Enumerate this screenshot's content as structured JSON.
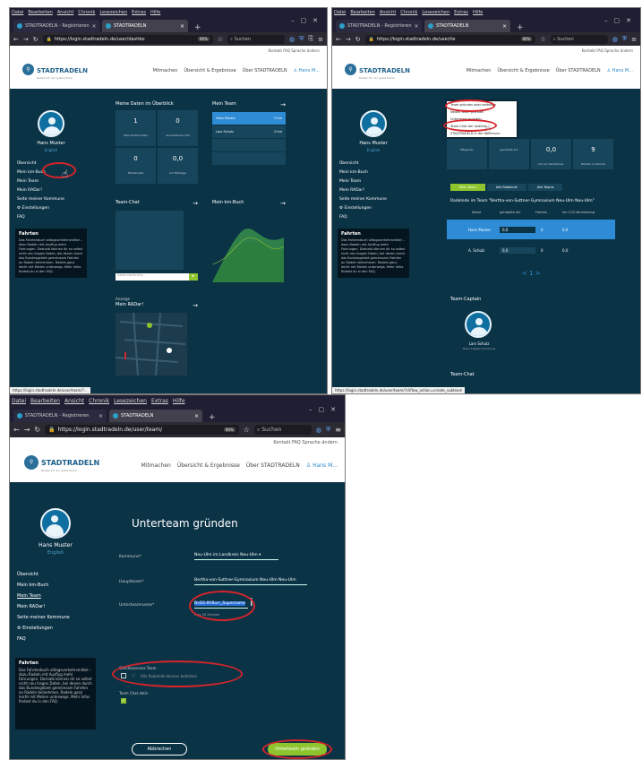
{
  "browser": {
    "menu": [
      "Datei",
      "Bearbeiten",
      "Ansicht",
      "Chronik",
      "Lesezeichen",
      "Extras",
      "Hilfe"
    ],
    "tab1_title": "STADTRADELN - Registrieren",
    "tab2_title": "STADTRADELN",
    "url1": "https://login.stadtradeln.de/user/dashbo",
    "url2": "https://login.stadtradeln.de/user/te",
    "url3": "https://login.stadtradeln.de/user/team/",
    "zoom": "90%",
    "search_placeholder": "Suchen"
  },
  "site": {
    "top_links": "Kontakt  FAQ  Sprache ändern",
    "logo": "STADTRADELN",
    "logo_sub": "Radeln für ein gutes Klima",
    "nav": [
      "Mitmachen",
      "Übersicht & Ergebnisse",
      "Über STADTRADELN"
    ],
    "nav_user": "Hans M..."
  },
  "sidebar": {
    "user_name": "Hans Muster",
    "lang": "English",
    "items": [
      "Übersicht",
      "Mein km-Buch",
      "Mein Team",
      "Mein RADar!",
      "Seite meiner Kommune",
      "Einstellungen",
      "FAQ"
    ],
    "faq_title": "Fahrten",
    "faq_text": "Das Fahrtenbuch alltagsverkehrsmittel – dazu Radeln mit Ausflug mehr Fahrungen. Deshalb können dir so selbst nicht neu tragen Daten, bei denen durch das Bundesgebiet gemeinsam Fahrten an Radeln teilnehmen. Radeln ganz leicht mit Meilen unterwegs. Mehr Infos findest du in den FAQ."
  },
  "s1": {
    "overview_title": "Meine Daten im Überblick",
    "tiles": [
      {
        "num": "1",
        "label": "Fahrrad-Kilometer"
      },
      {
        "num": "0",
        "label": "Vermiedenes CO2"
      },
      {
        "num": "0",
        "label": "Fahrtanzahl"
      },
      {
        "num": "0,0",
        "label": "km Fahrtage"
      }
    ],
    "team_title": "Mein Team",
    "team_rows": [
      {
        "name": "Hans Muster",
        "val": "0 km"
      },
      {
        "name": "Lars Schulz",
        "val": "0 km"
      }
    ],
    "chat_title": "Team-Chat",
    "chat_placeholder": "Deine Nachricht...",
    "kmbuch_title": "Mein km-Buch",
    "ad_title": "Anzeige",
    "radar_title": "Mein RADar!",
    "status": "https://login.stadtradeln.de/user/team/?..."
  },
  "s2": {
    "dropdown": [
      "Team gründen oder beitreten",
      "Neues Team gründen",
      "Unterteam gründen",
      "Team-Chat der anderen",
      "STADTRADELN in der Kommune"
    ],
    "tiles": [
      {
        "num": "",
        "label": "Mitglieder"
      },
      {
        "num": "",
        "label": "geradelte km"
      },
      {
        "num": "0,0",
        "label": "km pro Teilnehmer"
      },
      {
        "num": "9",
        "label": "Fahrten in Summe"
      }
    ],
    "tabs": [
      "Mein Team",
      "Alle Radelnde",
      "Alle Teams"
    ],
    "ranking_title": "Radelnde im Team \"Bertha-von-Suttner-Gymnasium Neu-Ulm Neu-Ulm\"",
    "cols": [
      "Name",
      "geradelte km",
      "Fahrten",
      "km CO2-Vermeidung"
    ],
    "rows": [
      {
        "name": "Hans Muster",
        "km": "0,0",
        "f": "0",
        "co2": "0,0"
      },
      {
        "name": "A. Schulz",
        "km": "0,0",
        "f": "0",
        "co2": "0,0"
      }
    ],
    "pager": "< 1 >",
    "captain_title": "Team-Captain",
    "captain_name": "Lars Schulz",
    "captain_sub": "Team-Captain Kommune",
    "teamchat_title": "Team-Chat",
    "status": "https://login.stadtradeln.de/user/team/?cliflow_action=create_subteam"
  },
  "s3": {
    "heading": "Unterteam gründen",
    "kommune_label": "Kommune*",
    "kommune_value": "Neu-Ulm im Landkreis Neu-Ulm",
    "hauptteam_label": "Hauptteam*",
    "hauptteam_value": "Bertha-von-Suttner-Gymnasium Neu-Ulm Neu-Ulm",
    "unterteam_label": "Unterteamname*",
    "unterteam_value": "BvSG-8f-Burr_Supername",
    "unterteam_hint": "max 30 Zeichen",
    "closed_label": "Geschlossenes Team",
    "closed_hint": "Alle Radelnde können beitreten",
    "chat_label": "Team Chat aktiv",
    "cancel": "Abbrechen",
    "submit": "Unterteam gründen"
  }
}
